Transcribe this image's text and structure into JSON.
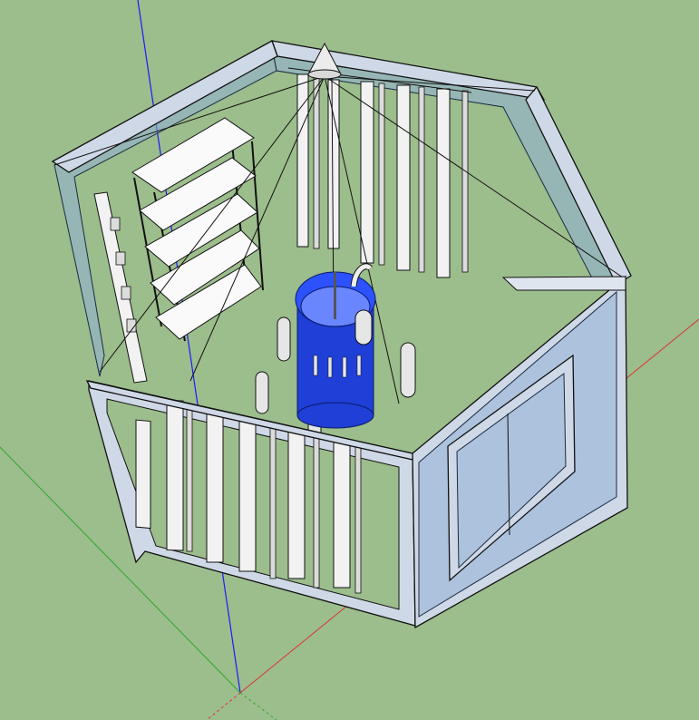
{
  "scene": {
    "background_color": "#9cbd8c",
    "axes": {
      "blue_axis_color": "#1a1aff",
      "red_axis_color": "#d33",
      "green_axis_color": "#2eaa2e"
    },
    "model_colors": {
      "frame": "#cfd8e6",
      "glass": "#8fb0d6",
      "tank": "#1f3fd6",
      "panel": "#f2f2f2"
    },
    "objects": [
      "hexagonal-enclosure",
      "blue-tank",
      "cone-apex",
      "shelving-unit",
      "door",
      "wall-panels",
      "posts"
    ]
  }
}
